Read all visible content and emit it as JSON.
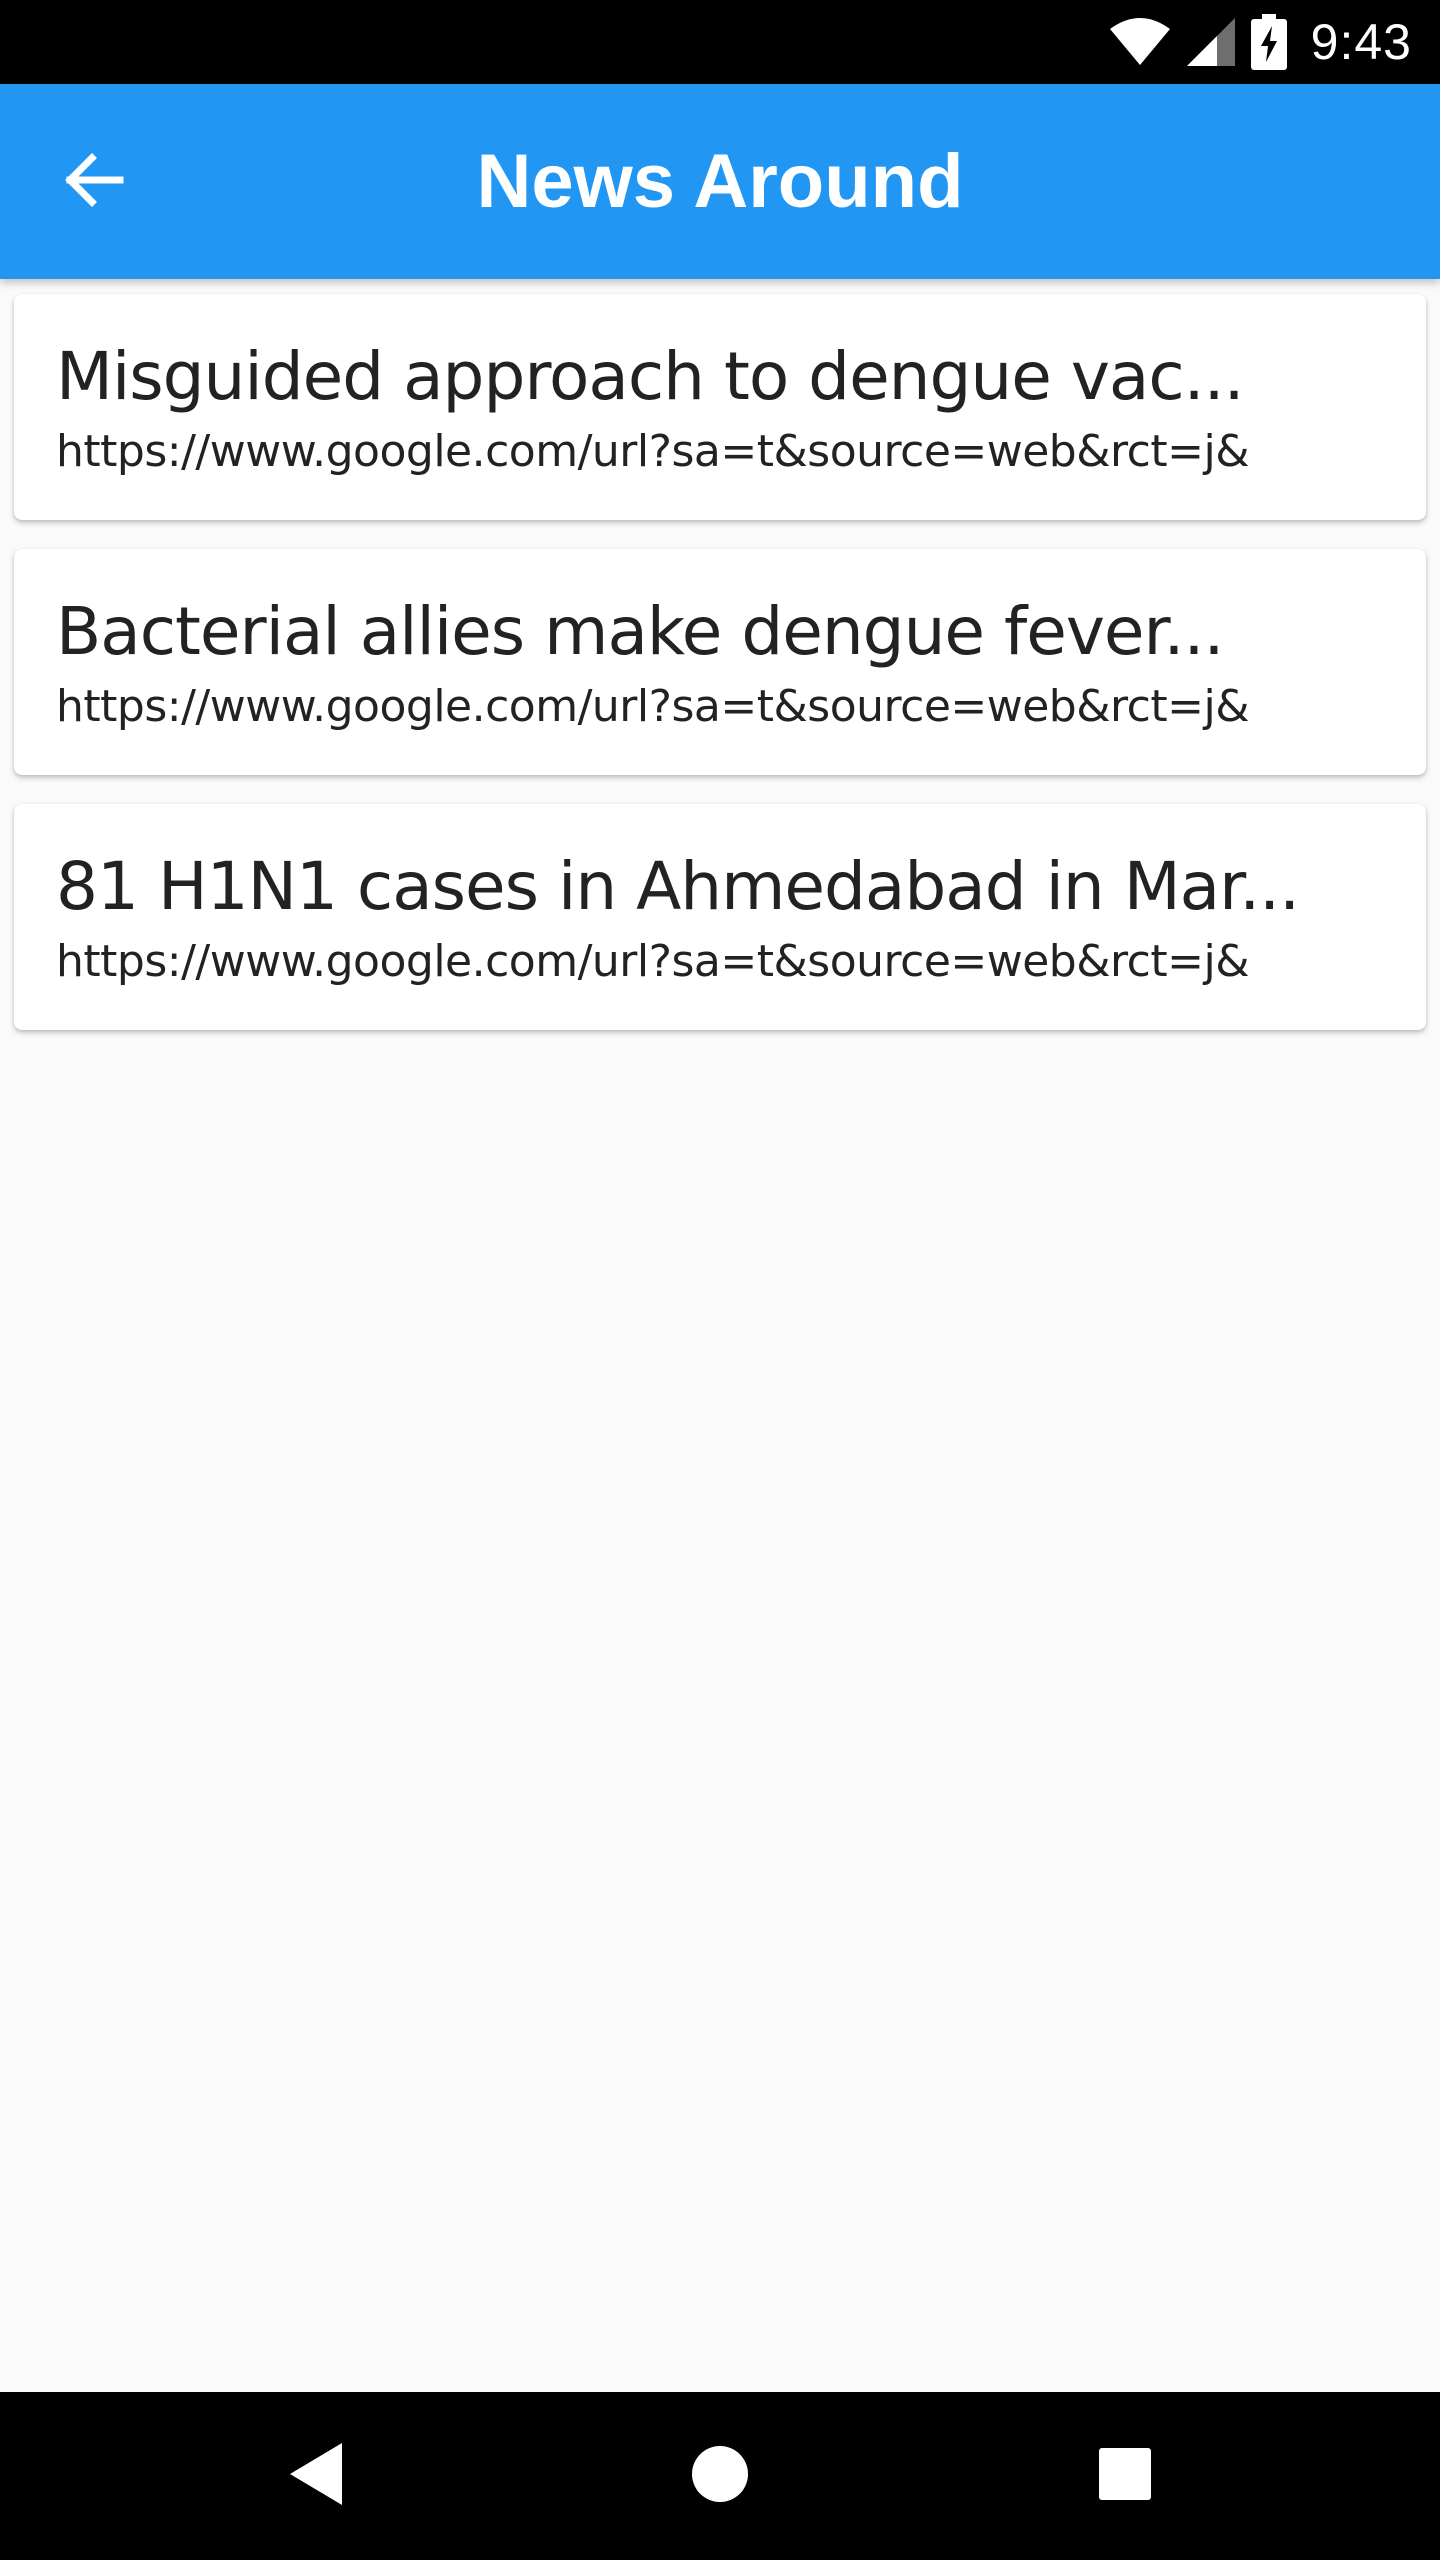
{
  "status_bar": {
    "time": "9:43",
    "icons": [
      "wifi-icon",
      "signal-icon",
      "battery-charging-icon"
    ]
  },
  "app_bar": {
    "title": "News Around",
    "back_icon": "arrow-back-icon"
  },
  "news": [
    {
      "title": "Misguided approach to dengue vac...",
      "url": "https://www.google.com/url?sa=t&source=web&rct=j&"
    },
    {
      "title": "Bacterial allies make dengue fever...",
      "url": "https://www.google.com/url?sa=t&source=web&rct=j&"
    },
    {
      "title": "81 H1N1 cases in Ahmedabad in Mar...",
      "url": "https://www.google.com/url?sa=t&source=web&rct=j&"
    }
  ],
  "nav_bar": {
    "icons": [
      "back-triangle-icon",
      "home-circle-icon",
      "recents-square-icon"
    ]
  },
  "colors": {
    "app_bar": "#2196f3",
    "background": "#fafafa",
    "card": "#ffffff",
    "text": "#222222"
  }
}
